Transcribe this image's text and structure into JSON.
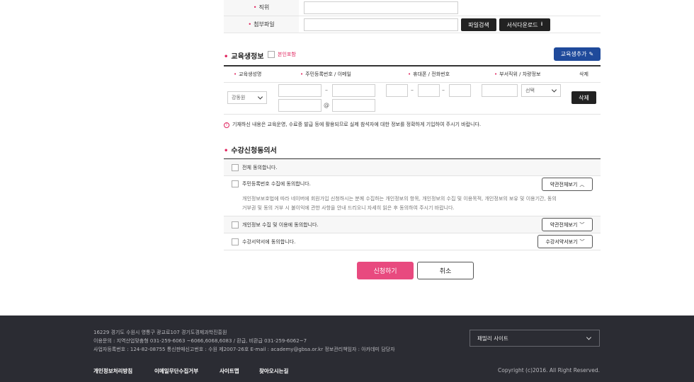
{
  "form_top": {
    "position_label": "직위",
    "attach_label": "첨부파일",
    "file_search_button": "파일검색",
    "template_download_button": "서식다운로드"
  },
  "trainee": {
    "title": "교육생정보",
    "include_self": "본인포함",
    "add_button": "교육생추가",
    "columns": [
      "교육생성명",
      "주민등록번호 / 이메일",
      "휴대폰 / 전화번호",
      "부서직위 / 차량정보",
      "삭제"
    ],
    "name_value": "강동원",
    "email_at": "@",
    "vehicle_select": "선택",
    "delete_button": "삭제",
    "notice": "기재하신 내용은 교육운영, 수료증 발급 등에 활용되므로 실제 참석자에 대한 정보를 정확하게 기입하여 주시기 바랍니다."
  },
  "consent": {
    "title": "수강신청동의서",
    "all_agree": "전체 동의합니다.",
    "rrn_agree": "주민등록번호 수집에 동의합니다.",
    "rrn_view": "약관전체보기",
    "rrn_desc_1": "개인정보보호법에 따라 네이버에 회원가입 신청하시는 분께 수집하는 개인정보의 항목, 개인정보의 수집 및 이용목적, 개인정보의 보유 및 이용기간, 동의",
    "rrn_desc_2": "거부권 및 동의 거부 시 불이익에 관한 사항을 안내 드리오니 자세히 읽은 후 동의하여 주시기 바랍니다.",
    "privacy_agree": "개인정보 수집 및 이용에 동의합니다.",
    "privacy_view": "약관전체보기",
    "pledge_agree": "수강서약서에 동의합니다.",
    "pledge_view": "수강서약서보기"
  },
  "actions": {
    "submit": "신청하기",
    "cancel": "취소"
  },
  "footer": {
    "address": "16229 경기도 수원시 영통구 광교로107 경기도경제과학진흥원",
    "contact": "이용문의 : 지역산업맞춤형 031-259-6063 ~6066,6068,6083 / 환급, 비환급 031-259-6062~7",
    "business": "사업자등록번호 : 124-82-08755 통신판매신고번호 : 수원 제2007-26호 E-mail : academy@gbsa.or.kr 정보관리책임자 : 아카데미 담당자",
    "links": [
      "개인정보처리방침",
      "이메일무단수집거부",
      "사이트맵",
      "찾아오시는길"
    ],
    "family_site": "패밀리 사이트",
    "copyright": "Copyright (c)2016. All Right Reserved."
  },
  "colors": {
    "accent_pink": "#e84a7f",
    "required_red": "#e0245e",
    "add_blue": "#1f4a9b",
    "footer_bg": "#2b2c33"
  }
}
